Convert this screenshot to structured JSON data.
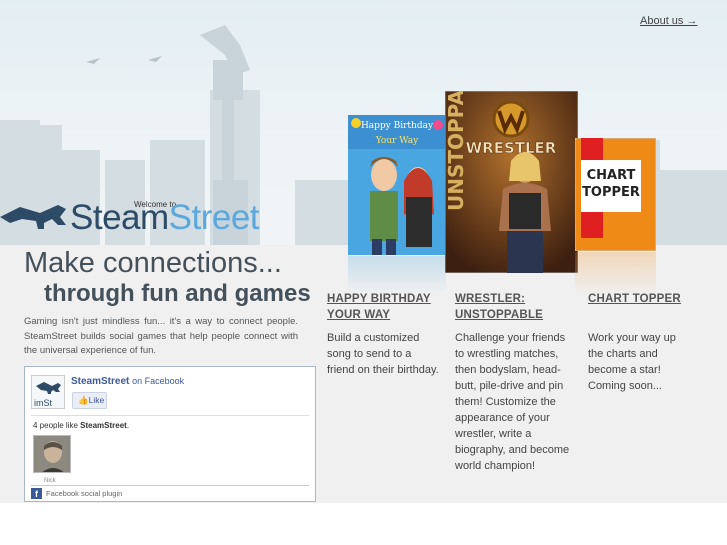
{
  "nav": {
    "about_label": "About us →"
  },
  "logo": {
    "welcome": "Welcome to",
    "steam": "Steam",
    "street": "Street"
  },
  "hero": {
    "headline_line1": "Make connections...",
    "headline_line2": "through fun and games",
    "intro": "Gaming isn't just mindless fun... it's a way to connect people. SteamStreet builds social games that help people connect with the universal experience of fun."
  },
  "facebook": {
    "page_name": "SteamStreet",
    "on_facebook": "on Facebook",
    "like_label": "Like",
    "count_prefix": "4 people like ",
    "count_name": "SteamStreet",
    "count_suffix": ".",
    "fan_name": "Nick",
    "footer": "Facebook social plugin",
    "logo_text": "imSt"
  },
  "games": [
    {
      "title_line1": "HAPPY BIRTHDAY",
      "title_line2": "YOUR WAY",
      "description": [
        "Build a customized",
        "song to send to a",
        "friend on their birthday."
      ],
      "art_text_1": "Happy Birthday",
      "art_text_2": "Your Way"
    },
    {
      "title_line1": "WRESTLER:",
      "title_line2": "UNSTOPPABLE",
      "description": [
        "Challenge your friends",
        "to wrestling matches,",
        "then bodyslam, head-",
        "butt, pile-drive and pin",
        "them! Customize the",
        "appearance of your",
        "wrestler, write a",
        "biography, and become",
        "world champion!"
      ],
      "art_text_1": "WRESTLER",
      "art_text_2": "UNSTOPPABLE"
    },
    {
      "title_line1": "CHART TOPPER",
      "title_line2": "",
      "description": [
        "Work your way up",
        "the charts and",
        "become a star!",
        "Coming soon..."
      ],
      "art_text_1": "CHART",
      "art_text_2": "TOPPER"
    }
  ],
  "colors": {
    "steam_dark": "#2d4a66",
    "street_blue": "#5ca8dc",
    "facebook_blue": "#3b5998",
    "chart_topper_orange": "#f08a17",
    "chart_topper_red": "#e02020",
    "birthday_blue": "#4aa6e0",
    "wrestler_brown": "#6b3a20"
  }
}
